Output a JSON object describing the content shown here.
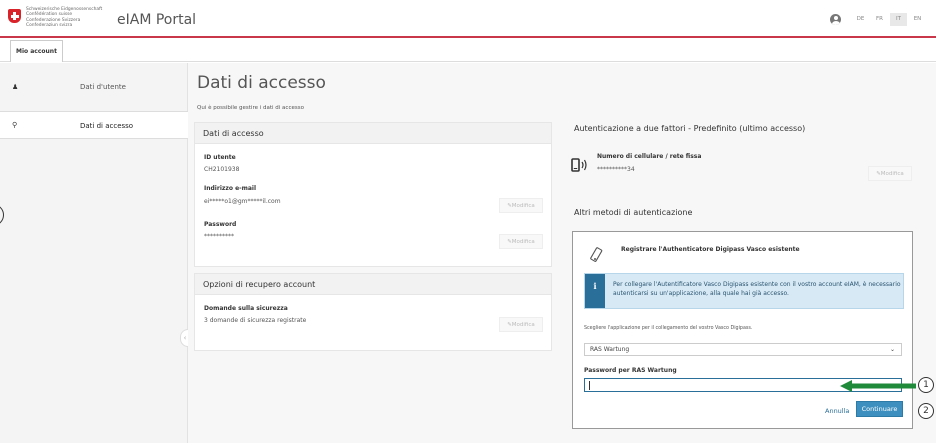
{
  "header": {
    "confed_lines": [
      "Schweizerische Eidgenossenschaft",
      "Confédération suisse",
      "Confederazione Svizzera",
      "Confederaziun svizra"
    ],
    "brand": "eIAM Portal",
    "languages": [
      "DE",
      "FR",
      "IT",
      "EN"
    ],
    "active_language": "IT"
  },
  "nav": {
    "tab": "Mio account"
  },
  "sidebar": {
    "items": [
      {
        "label": "Dati d'utente",
        "icon": "user-icon"
      },
      {
        "label": "Dati di accesso",
        "icon": "key-icon",
        "active": true
      }
    ]
  },
  "main": {
    "title": "Dati di accesso",
    "subtitle": "Qui è possibile gestire i dati di accesso"
  },
  "access_panel": {
    "title": "Dati di accesso",
    "user_id_label": "ID utente",
    "user_id_value": "CH2101938",
    "email_label": "Indirizzo e-mail",
    "email_value": "ei*****o1@gm*****il.com",
    "password_label": "Password",
    "password_value": "**********",
    "modify_label": "✎Modifica"
  },
  "recovery_panel": {
    "title": "Opzioni di recupero account",
    "security_label": "Domande sulla sicurezza",
    "security_value": "3 domande di sicurezza registrate",
    "modify_label": "✎Modifica"
  },
  "twofa": {
    "title": "Autenticazione a due fattori - Predefinito (ultimo accesso)",
    "phone_label": "Numero di cellulare / rete fissa",
    "phone_value": "**********34",
    "modify_label": "✎Modifica",
    "other_title": "Altri metodi di autenticazione"
  },
  "digipass": {
    "title": "Registrare l'Authenticatore Digipass Vasco esistente",
    "info": "Per collegare l'Autentificatore Vasco Digipass esistente con il vostro account eIAM, è necessario autenticarsi su un'applicazione, alla quale hai già accesso.",
    "choose_label": "Scegliere l'applicazione per il collegamento del vostro Vasco Digipass.",
    "selected_app": "RAS Wartung",
    "password_label": "Password per RAS Wartung",
    "password_value": "",
    "cancel": "Annulla",
    "continue": "Continuare"
  },
  "annotations": {
    "step1": "1",
    "step2": "2"
  },
  "colors": {
    "accent": "#3c8fbf",
    "header_line": "#c8374a",
    "arrow": "#1f8a3a"
  }
}
